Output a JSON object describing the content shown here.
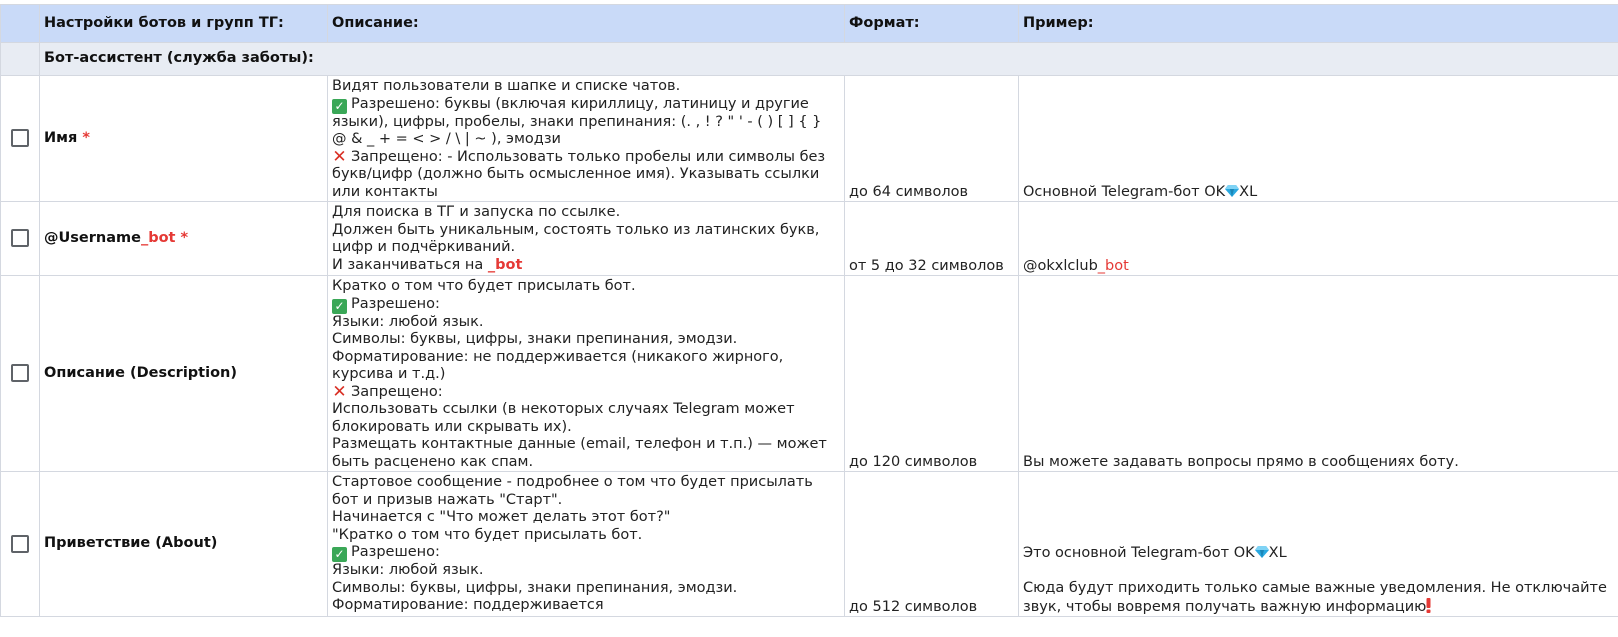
{
  "header": {
    "col_settings": "Настройки ботов и групп ТГ:",
    "col_description": "Описание:",
    "col_format": "Формат:",
    "col_example": "Пример:"
  },
  "section": {
    "title": "Бот-ассистент (служба заботы):"
  },
  "rows": [
    {
      "name": "Имя",
      "required_mark": "*",
      "desc_intro": "Видят пользователи в шапке и списке чатов.",
      "desc_allowed": "Разрешено: буквы (включая кириллицу, латиницу и другие языки), цифры, пробелы, знаки препинания: (. , ! ? \" ' - ( ) [ ] { } @ & _ + = < > / \\ | ~ ), эмодзи",
      "desc_forbidden": "Запрещено: - Использовать только пробелы или символы без букв/цифр (должно быть осмысленное имя). Указывать ссылки или контакты",
      "format": "до 64 символов",
      "example_prefix": "Основной Telegram-бот OK",
      "example_suffix": "XL"
    },
    {
      "name_prefix": "@Username",
      "name_suffix": "_bot",
      "required_mark": "*",
      "desc_line1": "Для поиска в ТГ и запуска по ссылке.",
      "desc_line2": "Должен быть уникальным, состоять только из латинских букв, цифр и подчёркиваний.",
      "desc_line3_prefix": "И заканчиваться на",
      "desc_line3_suffix": "_bot",
      "format": "от 5 до 32 символов",
      "example_prefix": "@okxlclub",
      "example_suffix": "_bot"
    },
    {
      "name": "Описание (Description)",
      "desc_intro": "Кратко о том что будет присылать бот.",
      "desc_allowed_title": "Разрешено:",
      "desc_lang": "Языки: любой язык.",
      "desc_symbols": "Символы: буквы, цифры, знаки препинания, эмодзи.",
      "desc_formatting": "Форматирование: не поддерживается (никакого жирного, курсива и т.д.)",
      "desc_forbidden_title": "Запрещено:",
      "desc_links": "Использовать ссылки (в некоторых случаях Telegram может блокировать или скрывать их).",
      "desc_contacts": "Размещать контактные данные (email, телефон и т.п.) — может быть расценено как спам.",
      "format": "до 120 символов",
      "example": "Вы можете задавать вопросы прямо в сообщениях боту."
    },
    {
      "name": "Приветствие (About)",
      "desc_intro": "Стартовое сообщение - подробнее о том что будет присылать бот и призыв нажать \"Старт\".",
      "desc_starts": "Начинается с \"Что может делать этот бот?\"",
      "desc_brief": "\"Кратко о том что будет присылать бот.",
      "desc_allowed_title": "Разрешено:",
      "desc_lang": "Языки: любой язык.",
      "desc_symbols": "Символы: буквы, цифры, знаки препинания, эмодзи.",
      "desc_formatting": "Форматирование: поддерживается",
      "format": "до 512 символов",
      "example_line1_prefix": "Это основной Telegram-бот OK",
      "example_line1_suffix": "XL",
      "example_line2": "Сюда будут приходить только самые важные уведомления. Не отключайте звук, чтобы вовремя получать важную информацию"
    }
  ],
  "icons": {
    "checkbox": "checkbox-icon",
    "allowed": "check-mark-icon",
    "forbidden": "cross-mark-icon",
    "gem": "gem-icon",
    "exclamation": "exclamation-icon"
  },
  "colors": {
    "header_bg": "#c9daf8",
    "section_bg": "#e8ecf3",
    "accent_red": "#e53935",
    "allowed_green": "#3aa757",
    "gem_blue": "#29a8e0"
  }
}
